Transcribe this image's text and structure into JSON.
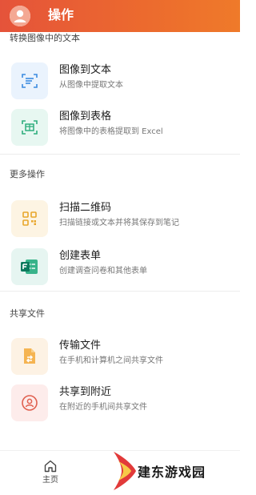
{
  "header": {
    "title": "操作",
    "avatar_icon": "user-avatar-icon",
    "gradient_start": "#e5533a",
    "gradient_end": "#ef7a2a"
  },
  "sections": [
    {
      "label": "转换图像中的文本",
      "items": [
        {
          "title": "图像到文本",
          "subtitle": "从图像中提取文本",
          "icon": "image-to-text-icon",
          "bg": "#eaf3fd",
          "color": "#3b8be0"
        },
        {
          "title": "图像到表格",
          "subtitle": "将图像中的表格提取到 Excel",
          "icon": "image-to-table-icon",
          "bg": "#e7f7f1",
          "color": "#2fae7e"
        }
      ]
    },
    {
      "label": "更多操作",
      "items": [
        {
          "title": "扫描二维码",
          "subtitle": "扫描链接或文本并将其保存到笔记",
          "icon": "qr-code-icon",
          "bg": "#fdf4e3",
          "color": "#e8a62b"
        },
        {
          "title": "创建表单",
          "subtitle": "创建调查问卷和其他表单",
          "icon": "forms-icon",
          "bg": "#e6f5f1",
          "color": "#0c7a5d"
        }
      ]
    },
    {
      "label": "共享文件",
      "items": [
        {
          "title": "传输文件",
          "subtitle": "在手机和计算机之间共享文件",
          "icon": "transfer-file-icon",
          "bg": "#fdf2e4",
          "color": "#f0a035"
        },
        {
          "title": "共享到附近",
          "subtitle": "在附近的手机间共享文件",
          "icon": "share-nearby-icon",
          "bg": "#fdeceb",
          "color": "#e0604f"
        }
      ]
    }
  ],
  "bottom_nav": {
    "home_label": "主页",
    "home_icon": "home-icon"
  },
  "watermark": {
    "text": "建东游戏园"
  }
}
